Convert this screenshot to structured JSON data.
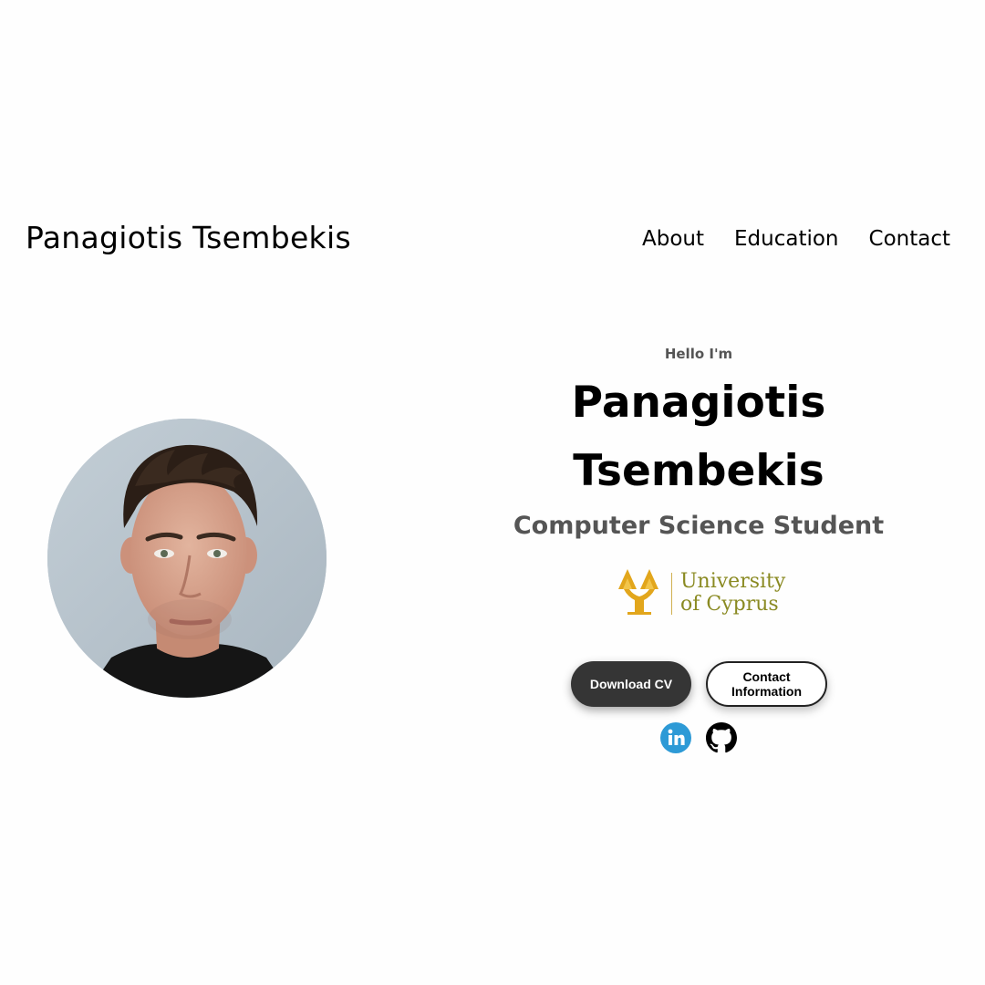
{
  "header": {
    "brand": "Panagiotis Tsembekis",
    "nav": [
      "About",
      "Education",
      "Contact"
    ]
  },
  "profile": {
    "photo_icon": "profile-photo",
    "hello": "Hello I'm",
    "name_line1": "Panagiotis",
    "name_line2": "Tsembekis",
    "role": "Computer Science Student"
  },
  "university": {
    "line1": "University",
    "line2": "of Cyprus",
    "icon": "university-of-cyprus-logo"
  },
  "buttons": {
    "download_cv": "Download CV",
    "contact_info_line1": "Contact",
    "contact_info_line2": "Information"
  },
  "social": {
    "linkedin_icon": "linkedin-icon",
    "github_icon": "github-icon",
    "linkedin_color": "#2d9ad6",
    "github_color": "#000000"
  },
  "colors": {
    "background": "#fefefe",
    "dark_button": "#353535",
    "muted_text": "#555555",
    "university_text": "#8a8a22",
    "university_gold": "#e2a61c"
  }
}
